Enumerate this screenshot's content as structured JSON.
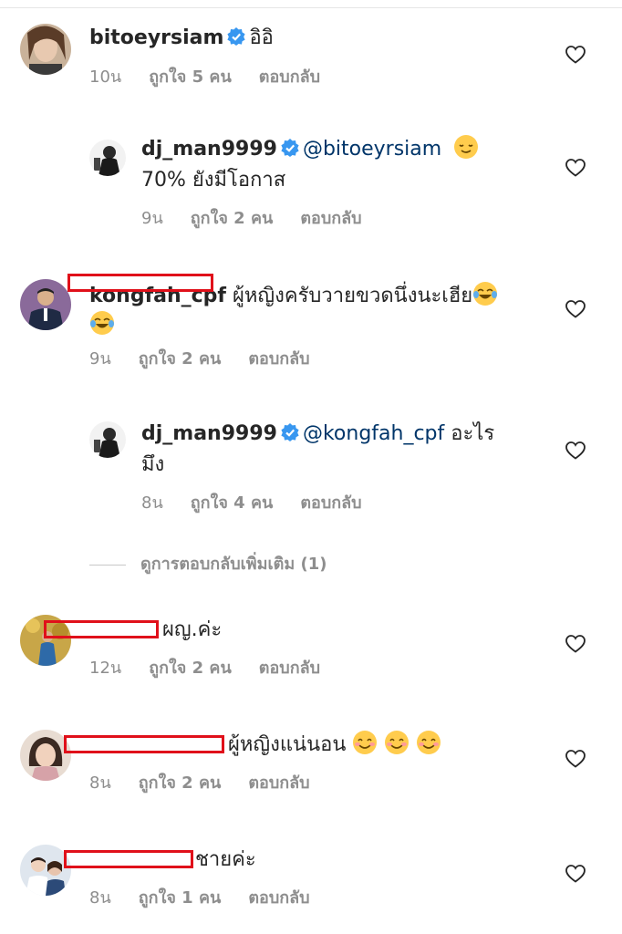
{
  "comments": [
    {
      "username": "bitoeyrsiam",
      "verified": true,
      "text": "อิอิ",
      "time": "10น",
      "likes": "ถูกใจ 5 คน",
      "reply": "ตอบกลับ"
    },
    {
      "username": "dj_man9999",
      "verified": true,
      "mention": "@bitoeyrsiam",
      "text_cont": "70% ยังมีโอกาส",
      "time": "9น",
      "likes": "ถูกใจ 2 คน",
      "reply": "ตอบกลับ"
    },
    {
      "username": "kongfah_cpf",
      "text": "ผู้หญิงครับวายขวดนึ่งนะเฮีย",
      "time": "9น",
      "likes": "ถูกใจ 2 คน",
      "reply": "ตอบกลับ"
    },
    {
      "username": "dj_man9999",
      "verified": true,
      "mention": "@kongfah_cpf",
      "text": "อะไร",
      "text_cont": "มึง",
      "time": "8น",
      "likes": "ถูกใจ 4 คน",
      "reply": "ตอบกลับ"
    },
    {
      "text": "ผญ.ค่ะ",
      "time": "12น",
      "likes": "ถูกใจ 2 คน",
      "reply": "ตอบกลับ"
    },
    {
      "text": "ผู้หญิงแน่นอน",
      "time": "8น",
      "likes": "ถูกใจ 2 คน",
      "reply": "ตอบกลับ"
    },
    {
      "text": "ชายค่ะ",
      "time": "8น",
      "likes": "ถูกใจ 1 คน",
      "reply": "ตอบกลับ"
    }
  ],
  "view_more_replies": "ดูการตอบกลับเพิ่มเติม (1)",
  "colors": {
    "verified": "#3897f0",
    "mention": "#003569",
    "meta": "#8e8e8e",
    "redaction": "#e0101a"
  },
  "icons": [
    "heart-outline-icon",
    "verified-badge-icon",
    "emoji-relieved-icon",
    "emoji-tears-of-joy-icon",
    "emoji-smile-icon"
  ]
}
